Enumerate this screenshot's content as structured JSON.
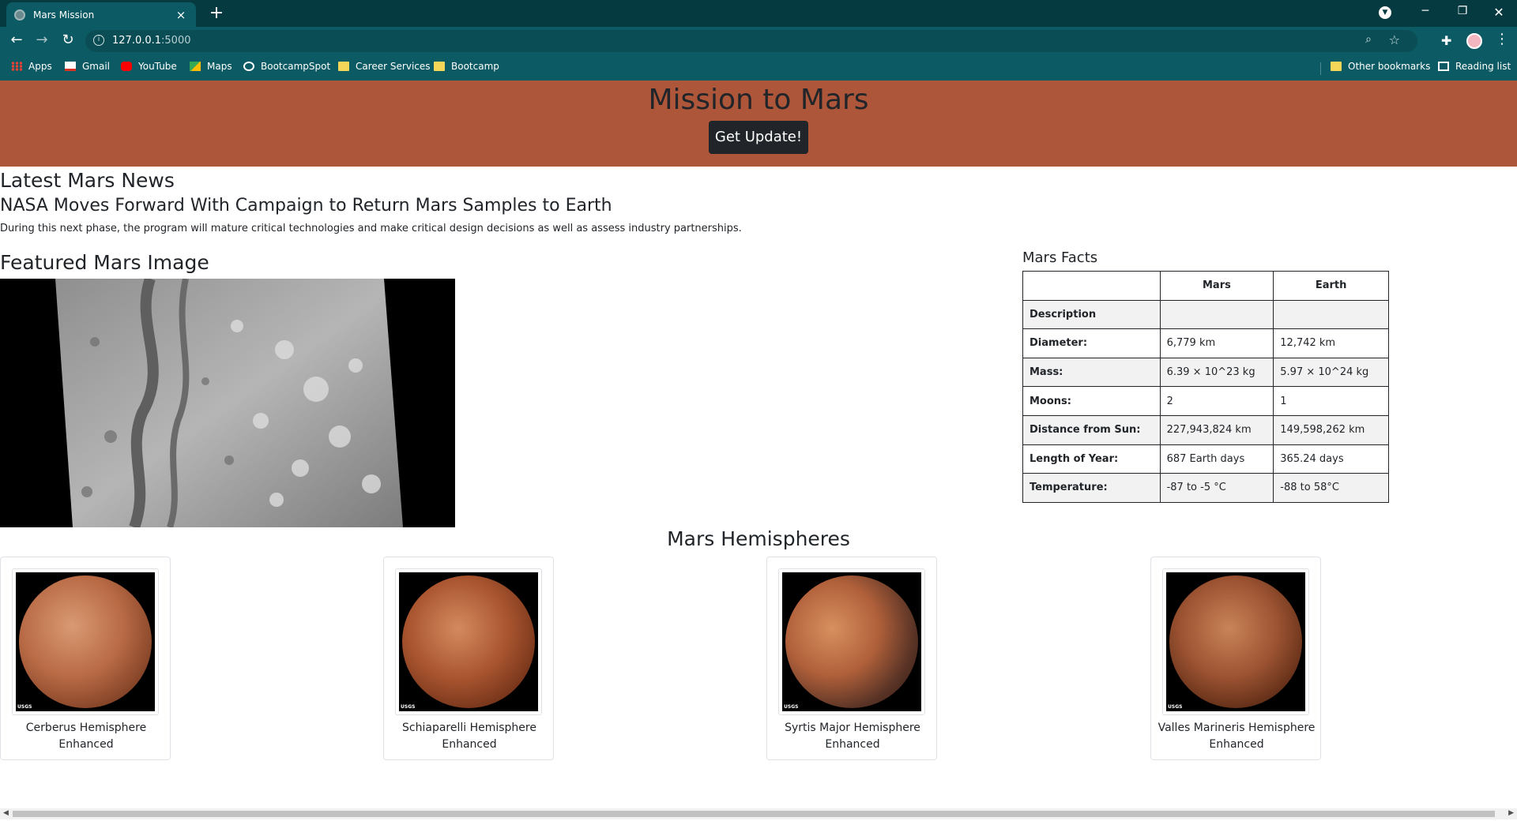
{
  "browser": {
    "tab_title": "Mars Mission",
    "tab_close": "×",
    "new_tab": "+",
    "url_host": "127.0.0.1",
    "url_port": ":5000",
    "window_controls": {
      "minimize": "─",
      "maximize": "❐",
      "close": "✕"
    },
    "bookmarks": [
      {
        "label": "Apps",
        "icon": "apps-grid-icon"
      },
      {
        "label": "Gmail",
        "icon": "gmail-icon"
      },
      {
        "label": "YouTube",
        "icon": "youtube-icon"
      },
      {
        "label": "Maps",
        "icon": "maps-icon"
      },
      {
        "label": "BootcampSpot",
        "icon": "globe-icon"
      },
      {
        "label": "Career Services",
        "icon": "folder-icon"
      },
      {
        "label": "Bootcamp",
        "icon": "folder-icon"
      }
    ],
    "other_bookmarks": "Other bookmarks",
    "reading_list": "Reading list"
  },
  "page": {
    "title": "Mission to Mars",
    "update_button": "Get Update!",
    "news_heading": "Latest Mars News",
    "news_title": "NASA Moves Forward With Campaign to Return Mars Samples to Earth",
    "news_paragraph": "During this next phase, the program will mature critical technologies and make critical design decisions as well as assess industry partnerships.",
    "featured_heading": "Featured Mars Image",
    "facts_heading": "Mars Facts",
    "facts_table": {
      "columns": [
        "",
        "Mars",
        "Earth"
      ],
      "rows": [
        [
          "Description",
          "",
          ""
        ],
        [
          "Diameter:",
          "6,779 km",
          "12,742 km"
        ],
        [
          "Mass:",
          "6.39 × 10^23 kg",
          "5.97 × 10^24 kg"
        ],
        [
          "Moons:",
          "2",
          "1"
        ],
        [
          "Distance from Sun:",
          "227,943,824 km",
          "149,598,262 km"
        ],
        [
          "Length of Year:",
          "687 Earth days",
          "365.24 days"
        ],
        [
          "Temperature:",
          "-87 to -5 °C",
          "-88 to 58°C"
        ]
      ]
    },
    "hemispheres_heading": "Mars Hemispheres",
    "hemispheres": [
      {
        "line1": "Cerberus Hemisphere",
        "line2": "Enhanced"
      },
      {
        "line1": "Schiaparelli Hemisphere",
        "line2": "Enhanced"
      },
      {
        "line1": "Syrtis Major Hemisphere",
        "line2": "Enhanced"
      },
      {
        "line1": "Valles Marineris Hemisphere",
        "line2": "Enhanced"
      }
    ],
    "image_logo": "USGS"
  }
}
